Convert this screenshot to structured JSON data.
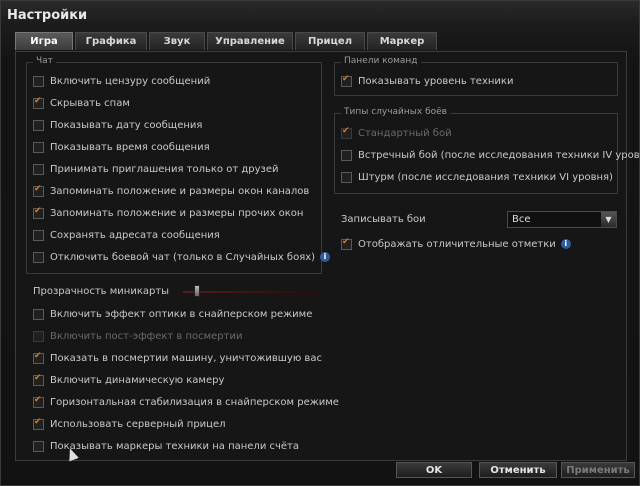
{
  "window": {
    "title": "Настройки"
  },
  "tabs": [
    {
      "label": "Игра",
      "active": true
    },
    {
      "label": "Графика"
    },
    {
      "label": "Звук"
    },
    {
      "label": "Управление"
    },
    {
      "label": "Прицел"
    },
    {
      "label": "Маркер"
    }
  ],
  "chat": {
    "label": "Чат",
    "items": [
      {
        "label": "Включить цензуру сообщений",
        "checked": false
      },
      {
        "label": "Скрывать спам",
        "checked": true
      },
      {
        "label": "Показывать дату сообщения",
        "checked": false
      },
      {
        "label": "Показывать время сообщения",
        "checked": false
      },
      {
        "label": "Принимать приглашения только от друзей",
        "checked": false
      },
      {
        "label": "Запоминать положение и размеры окон каналов",
        "checked": true
      },
      {
        "label": "Запоминать положение и размеры прочих окон",
        "checked": true
      },
      {
        "label": "Сохранять адресата сообщения",
        "checked": false
      },
      {
        "label": "Отключить боевой чат (только в Случайных боях)",
        "checked": false,
        "info": "i"
      }
    ]
  },
  "minimap": {
    "label": "Прозрачность миникарты",
    "value_fraction": 0.08
  },
  "game": {
    "items": [
      {
        "label": "Включить эффект оптики в снайперском режиме",
        "checked": false
      },
      {
        "label": "Включить пост-эффект в посмертии",
        "checked": false,
        "disabled": true
      },
      {
        "label": "Показать в посмертии машину, уничтожившую вас",
        "checked": true
      },
      {
        "label": "Включить динамическую камеру",
        "checked": true
      },
      {
        "label": "Горизонтальная стабилизация в снайперском режиме",
        "checked": true
      },
      {
        "label": "Использовать серверный прицел",
        "checked": true
      },
      {
        "label": "Показывать маркеры техники на панели счёта",
        "checked": false
      }
    ]
  },
  "panels": {
    "label": "Панели команд",
    "items": [
      {
        "label": "Показывать уровень техники",
        "checked": true
      }
    ]
  },
  "battle_types": {
    "label": "Типы случайных боёв",
    "items": [
      {
        "label": "Стандартный бой",
        "checked": true,
        "disabled": true
      },
      {
        "label": "Встречный бой (после исследования техники IV уровня)",
        "checked": false
      },
      {
        "label": "Штурм (после исследования техники VI уровня)",
        "checked": false
      }
    ]
  },
  "replay": {
    "label": "Записывать бои",
    "value": "Все",
    "arrow": "▼"
  },
  "marks": {
    "label": "Отображать отличительные отметки",
    "checked": true,
    "info": "i"
  },
  "buttons": {
    "ok": "OK",
    "cancel": "Отменить",
    "apply": "Применить"
  },
  "colors": {
    "accent": "#d97a2a",
    "info": "#2f5c9a"
  }
}
